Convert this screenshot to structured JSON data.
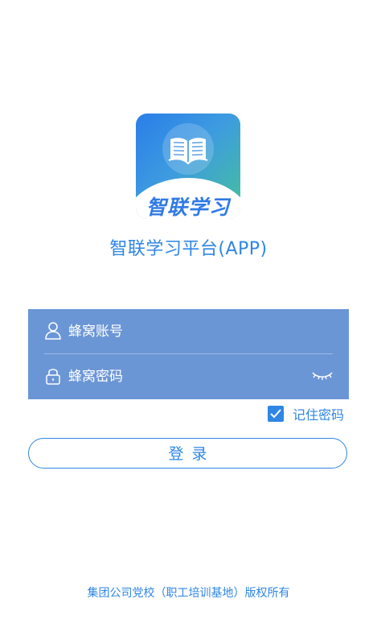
{
  "logo": {
    "text": "智联学习",
    "icon": "book-icon"
  },
  "app_title": "智联学习平台(APP)",
  "form": {
    "account_placeholder": "蜂窝账号",
    "password_placeholder": "蜂窝密码",
    "account_icon": "user-icon",
    "password_icon": "lock-icon",
    "visibility_icon": "eye-closed-icon"
  },
  "remember": {
    "label": "记住密码",
    "checked": true
  },
  "login_button": "登录",
  "footer": "集团公司党校（职工培训基地）版权所有",
  "colors": {
    "accent": "#2f86e4",
    "panel": "#6b96d6"
  }
}
